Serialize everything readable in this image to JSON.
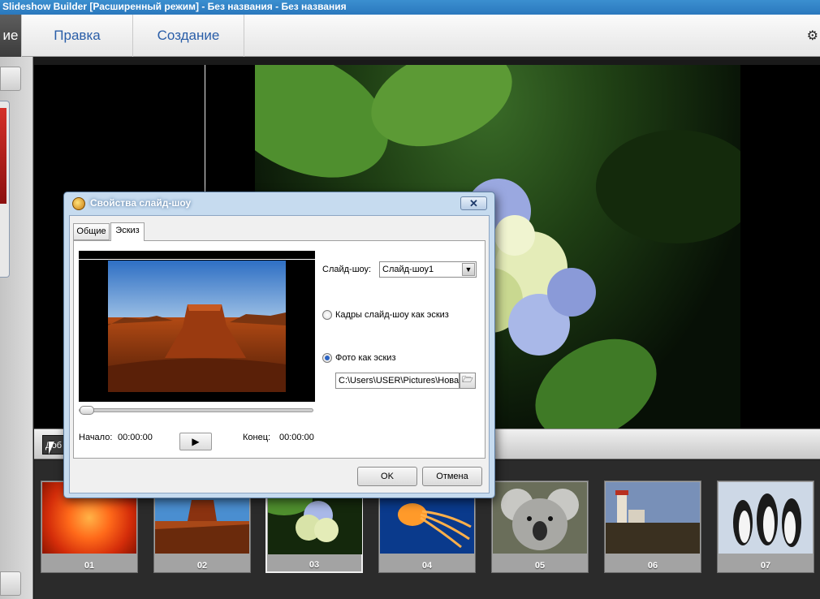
{
  "window": {
    "title": "Slideshow Builder [Расширенный режим] - Без названия - Без названия"
  },
  "menu": {
    "tabs": [
      {
        "label": "ие",
        "active": true
      },
      {
        "label": "Правка",
        "active": false
      },
      {
        "label": "Создание",
        "active": false
      }
    ],
    "settings_icon": "gear-icon"
  },
  "control_bar": {
    "add_label": "Доб"
  },
  "filmstrip": {
    "slides": [
      {
        "number": "01",
        "subject": "red-flower"
      },
      {
        "number": "02",
        "subject": "desert"
      },
      {
        "number": "03",
        "subject": "hydrangea",
        "selected": true
      },
      {
        "number": "04",
        "subject": "jellyfish"
      },
      {
        "number": "05",
        "subject": "koala"
      },
      {
        "number": "06",
        "subject": "lighthouse"
      },
      {
        "number": "07",
        "subject": "penguins"
      }
    ]
  },
  "dialog": {
    "title": "Свойства слайд-шоу",
    "close_label": "✕",
    "tabs": [
      {
        "label": "Общие",
        "active": false
      },
      {
        "label": "Эскиз",
        "active": true
      }
    ],
    "preview": {
      "start_label": "Начало:",
      "start_time": "00:00:00",
      "end_label": "Конец:",
      "end_time": "00:00:00",
      "play_label": "▶",
      "progress": 0
    },
    "slideshow_label": "Слайд-шоу:",
    "slideshow_value": "Слайд-шоу1",
    "option_frames": {
      "label": "Кадры слайд-шоу как эскиз",
      "selected": false
    },
    "option_photo": {
      "label": "Фото как эскиз",
      "selected": true
    },
    "photo_path": "C:\\Users\\USER\\Pictures\\Новая",
    "ok_label": "OK",
    "cancel_label": "Отмена"
  },
  "colors": {
    "titlebar": "#2a78bd",
    "menu_text": "#2a5ea8",
    "dialog_frame": "#c6dbef"
  }
}
